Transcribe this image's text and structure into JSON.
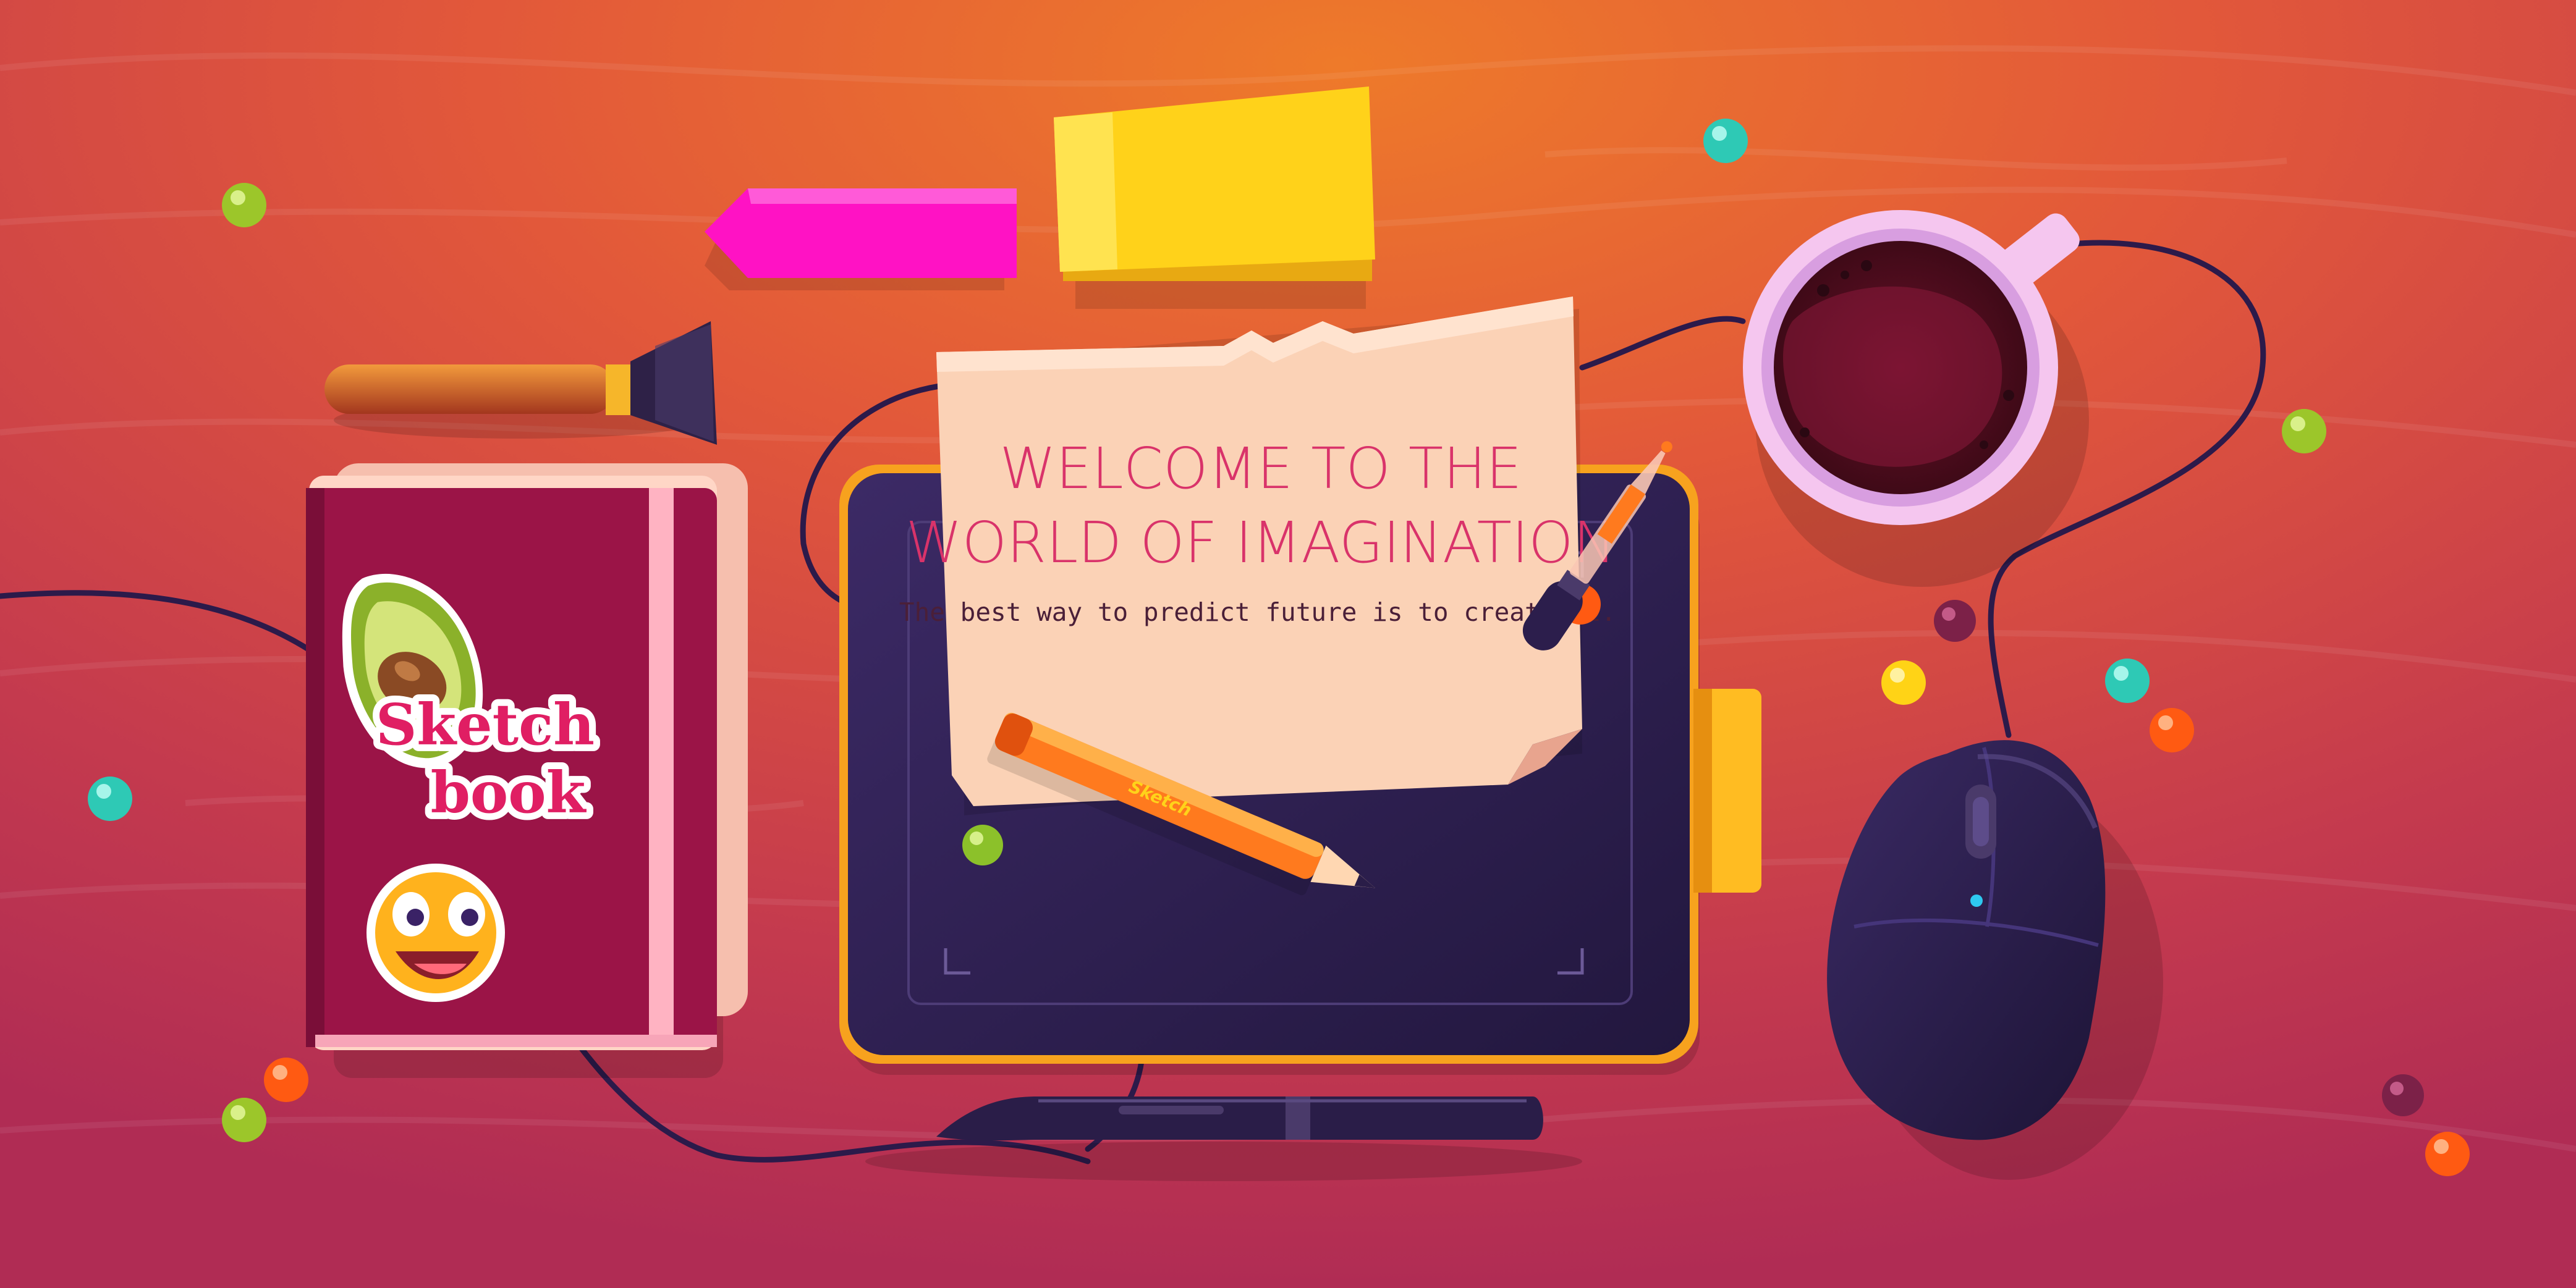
{
  "scene": {
    "headline_line1": "WELCOME TO THE",
    "headline_line2": "WORLD OF IMAGINATION",
    "tagline": "The best way to predict future is to create it.",
    "sketchbook_word1": "Sketch",
    "sketchbook_word2": "book",
    "pencil_brand": "Sketch"
  },
  "colors": {
    "desk_center": "#e8682e",
    "desk_edge": "#b82e52",
    "paper": "#fbd2b6",
    "headline": "#d9336a",
    "tagline": "#4a1f38",
    "sketchbook_cover": "#9b1447",
    "tablet": "#2b1d4a",
    "tablet_rim": "#f7a21e",
    "coffee": "#5b1024",
    "mug": "#f5c6ef",
    "mouse": "#2a1d48",
    "sticky_yellow": "#ffd21a",
    "sticky_pink": "#ff17c9",
    "cable": "#2c1a4a",
    "ball_green": "#9cc62a",
    "ball_teal": "#2ec9b5",
    "ball_orange": "#ff5a12",
    "ball_yellow": "#ffd316",
    "ball_purple": "#7c2148"
  },
  "icons": [
    "avocado-sticker",
    "smiley-sticker",
    "coffee-mug",
    "computer-mouse",
    "graphics-tablet",
    "stylus-pen",
    "paint-brush",
    "pencil",
    "dropper",
    "sticky-notes",
    "pushpin"
  ]
}
